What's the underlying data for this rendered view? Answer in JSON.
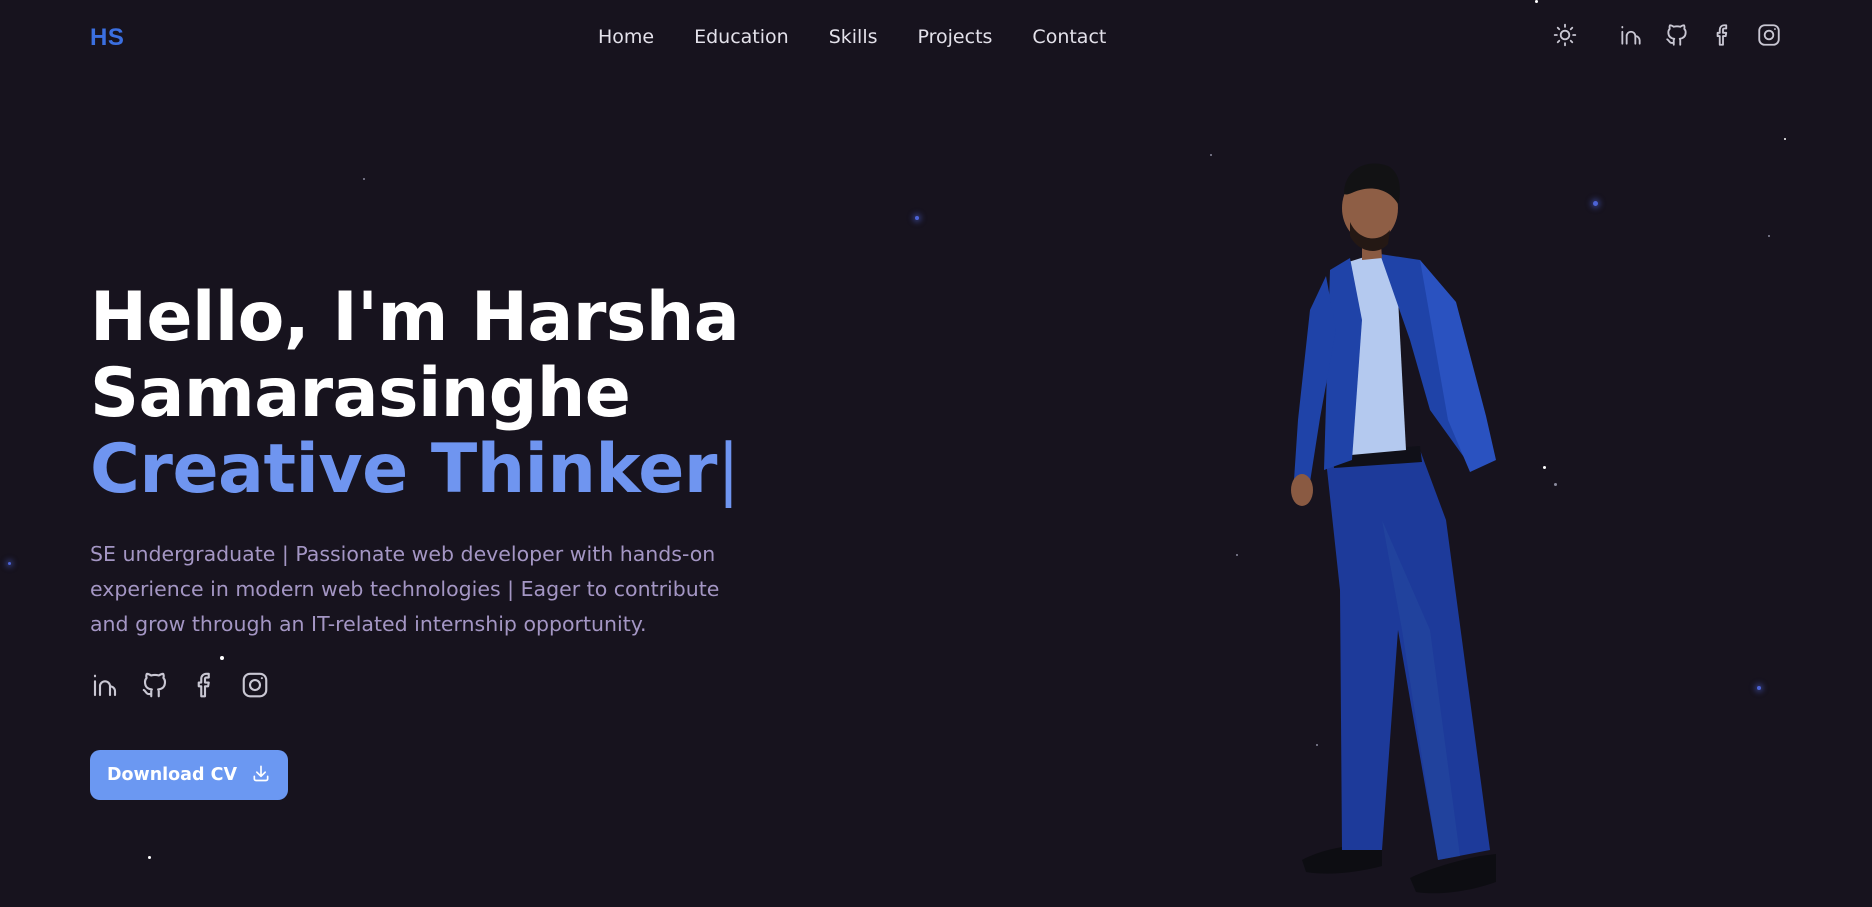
{
  "nav": {
    "logo": "HS",
    "links": [
      "Home",
      "Education",
      "Skills",
      "Projects",
      "Contact"
    ],
    "icons": [
      "sun-icon",
      "linkedin-icon",
      "github-icon",
      "facebook-icon",
      "instagram-icon"
    ]
  },
  "hero": {
    "greeting_line1": "Hello, I'm Harsha",
    "greeting_line2": "Samarasinghe",
    "role": "Creative Thinker",
    "cursor": "|",
    "description": "SE undergraduate | Passionate web developer with hands-on experience in modern web technologies | Eager to contribute and grow through an IT-related internship opportunity.",
    "social_icons": [
      "linkedin-icon",
      "github-icon",
      "facebook-icon",
      "instagram-icon"
    ],
    "cv_button": "Download CV"
  },
  "colors": {
    "background": "#17131e",
    "accent": "#6f95f0",
    "logo": "#3b6fe0",
    "button": "#6b98f2",
    "description": "#a496c4"
  }
}
